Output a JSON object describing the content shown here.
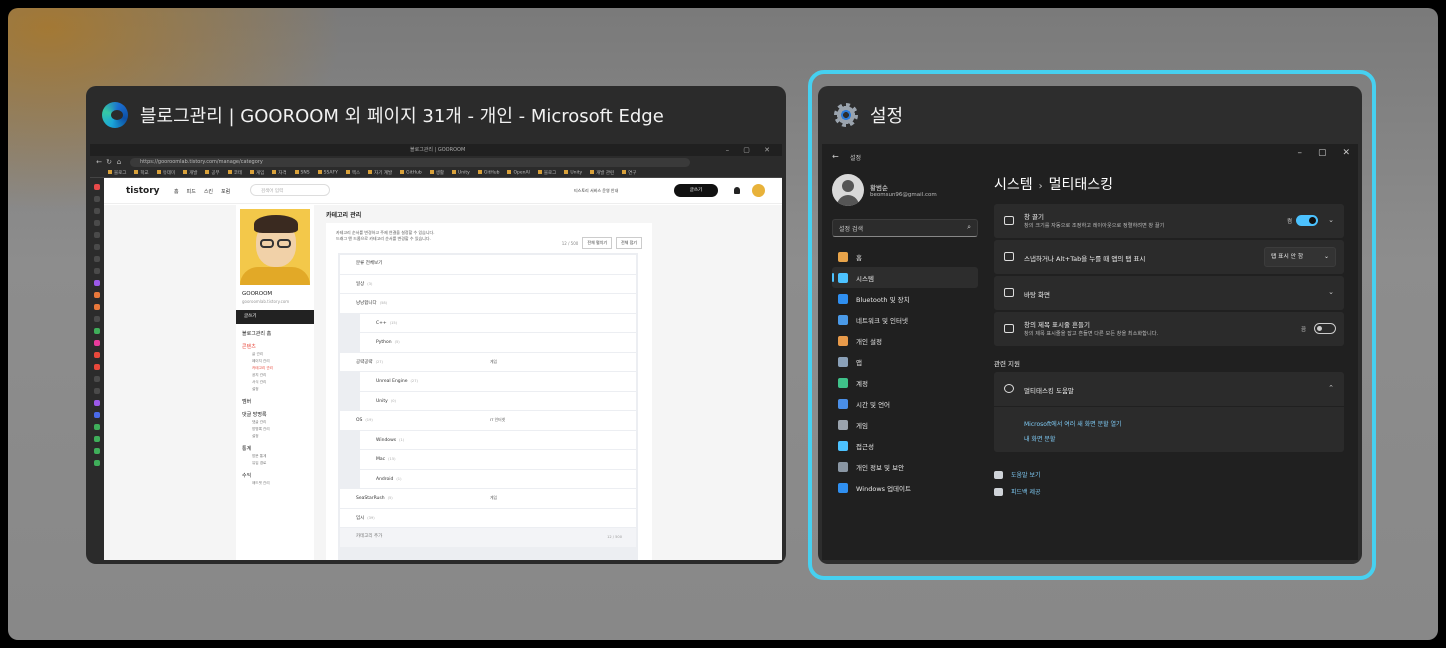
{
  "edge_window": {
    "title": "블로그관리 | GOOROOM 외 페이지 31개 - 개인 - Microsoft Edge",
    "app_icon": "edge-icon",
    "thumbnail": {
      "tab_title": "블로그관리 | GOOROOM",
      "url": "https://gooroomlab.tistory.com/manage/category",
      "bookmarks": [
        "블로그",
        "학교",
        "유데미",
        "개발",
        "공부",
        "코테",
        "게임",
        "자격",
        "SNS",
        "SSAFY",
        "엑스",
        "자기 계발",
        "GitHub",
        "생활",
        "Unity",
        "GitHub",
        "OpenAI",
        "블로그",
        "Unity",
        "개발 관련",
        "연구"
      ],
      "tistory": {
        "logo": "tistory",
        "nav": [
          "홈",
          "피드",
          "스킨",
          "포럼"
        ],
        "search_placeholder": "검색어 입력",
        "notice": "티스토리 서비스 운영 안내",
        "write_button": "글쓰기",
        "blog_name": "GOOROOM",
        "blog_url": "gooroomlab.tistory.com",
        "manage_label": "글쓰기",
        "side_sections": [
          {
            "title": "블로그관리 홈",
            "subs": [],
            "active": false
          },
          {
            "title": "콘텐츠",
            "subs": [
              "글 관리",
              "페이지 관리",
              "카테고리 관리",
              "공지 관리",
              "서식 관리",
              "설정"
            ],
            "active": true
          },
          {
            "title": "멤버",
            "subs": [],
            "active": false
          },
          {
            "title": "댓글 방명록",
            "subs": [
              "댓글 관리",
              "방명록 관리",
              "설정"
            ],
            "active": false
          },
          {
            "title": "통계",
            "subs": [
              "방문 통계",
              "유입 경로"
            ],
            "active": false
          },
          {
            "title": "수익",
            "subs": [
              "애드핏 관리"
            ],
            "active": false
          }
        ],
        "page_title": "카테고리 관리",
        "description": [
          "카테고리 순서를 변경하고 주제 연결을 설정할 수 있습니다.",
          "드래그 앤 드롭으로 카테고리 순서를 변경할 수 있습니다."
        ],
        "count_label": "12 / 500",
        "expand_button": "전체 펼치기",
        "collapse_button": "전체 접기",
        "categories": [
          {
            "name": "분류 전체보기",
            "count": "",
            "tag": "",
            "level": 1
          },
          {
            "name": "일상",
            "count": "(3)",
            "tag": "",
            "level": 1
          },
          {
            "name": "낭낭합니다",
            "count": "(58)",
            "tag": "",
            "level": 1
          },
          {
            "name": "C++",
            "count": "(15)",
            "tag": "",
            "level": 2
          },
          {
            "name": "Python",
            "count": "(5)",
            "tag": "",
            "level": 2
          },
          {
            "name": "공략공략",
            "count": "(27)",
            "tag": "게임",
            "level": 1
          },
          {
            "name": "Unreal Engine",
            "count": "(27)",
            "tag": "",
            "level": 2
          },
          {
            "name": "Unity",
            "count": "(0)",
            "tag": "",
            "level": 2
          },
          {
            "name": "OS",
            "count": "(19)",
            "tag": "IT 인터넷",
            "level": 1
          },
          {
            "name": "Windows",
            "count": "(1)",
            "tag": "",
            "level": 2
          },
          {
            "name": "Mac",
            "count": "(15)",
            "tag": "",
            "level": 2
          },
          {
            "name": "Android",
            "count": "(1)",
            "tag": "",
            "level": 2
          },
          {
            "name": "SeaStarRush",
            "count": "(5)",
            "tag": "게임",
            "level": 1
          },
          {
            "name": "임시",
            "count": "(39)",
            "tag": "",
            "level": 1
          }
        ],
        "add_category": "카테고리 추가",
        "add_count": "12 / 500"
      }
    }
  },
  "settings_window": {
    "title": "설정",
    "app_icon": "gear-icon",
    "thumbnail": {
      "app_title": "설정",
      "user_name": "황범순",
      "user_email": "beomsun96@gmail.com",
      "search_placeholder": "설정 검색",
      "nav": [
        {
          "label": "홈",
          "icon": "home-icon",
          "color": "#e8a44a"
        },
        {
          "label": "시스템",
          "icon": "system-icon",
          "color": "#4cc2ff",
          "selected": true
        },
        {
          "label": "Bluetooth 및 장치",
          "icon": "bluetooth-icon",
          "color": "#2f8ff0"
        },
        {
          "label": "네트워크 및 인터넷",
          "icon": "network-icon",
          "color": "#4a9ae8"
        },
        {
          "label": "개인 설정",
          "icon": "brush-icon",
          "color": "#e89a4a"
        },
        {
          "label": "앱",
          "icon": "apps-icon",
          "color": "#8aa0b8"
        },
        {
          "label": "계정",
          "icon": "account-icon",
          "color": "#3fc28a"
        },
        {
          "label": "시간 및 언어",
          "icon": "time-language-icon",
          "color": "#4a8fe8"
        },
        {
          "label": "게임",
          "icon": "gaming-icon",
          "color": "#9aa3ad"
        },
        {
          "label": "접근성",
          "icon": "accessibility-icon",
          "color": "#4cc2ff"
        },
        {
          "label": "개인 정보 및 보안",
          "icon": "shield-icon",
          "color": "#8a96a3"
        },
        {
          "label": "Windows 업데이트",
          "icon": "update-icon",
          "color": "#2f8ff0"
        }
      ],
      "breadcrumb_parent": "시스템",
      "breadcrumb_current": "멀티태스킹",
      "snap": {
        "title": "창 끌기",
        "desc": "창의 크기를 자동으로 조정하고 레이아웃으로 정렬하려면 창 끌기",
        "toggle_label": "켬",
        "on": true
      },
      "alt_tab": {
        "title": "스냅하거나 Alt+Tab을 누를 때 앱의 탭 표시",
        "value": "탭 표시 안 함"
      },
      "desktops": {
        "title": "바탕 화면"
      },
      "shake": {
        "title": "창의 제목 표시줄 흔들기",
        "desc": "창의 제목 표시줄을 잡고 흔들면 다른 모든 창을 최소화합니다.",
        "toggle_label": "끔",
        "on": false
      },
      "related_title": "관련 지원",
      "help": {
        "title": "멀티태스킹 도움말",
        "links": [
          "Microsoft에서 여러 새 화면 분할 열기",
          "내 화면 분할"
        ]
      },
      "footer": [
        {
          "label": "도움말 보기",
          "icon": "help-icon"
        },
        {
          "label": "피드백 제공",
          "icon": "feedback-icon"
        }
      ]
    }
  },
  "colors": {
    "selection_ring": "#46d0f0",
    "accent": "#4cc2ff",
    "link": "#7fcbf5",
    "tistory_active": "#e8483b"
  }
}
